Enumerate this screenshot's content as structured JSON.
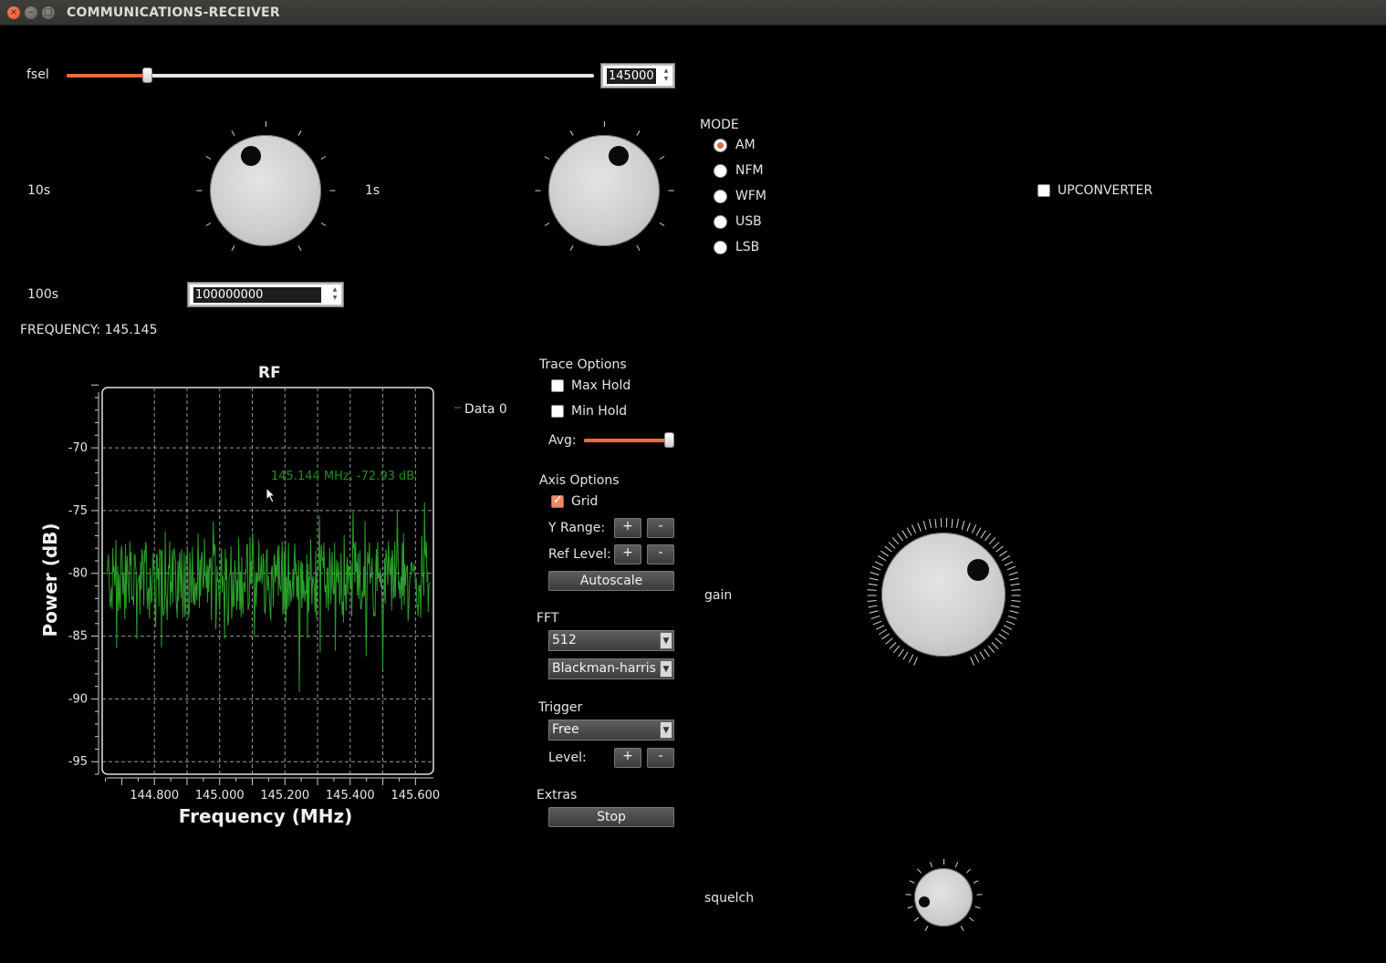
{
  "window": {
    "title": "COMMUNICATIONS-RECEIVER"
  },
  "fsel": {
    "label": "fsel",
    "value": "145000",
    "fraction": 0.152
  },
  "knobs": {
    "tens_label": "10s",
    "ones_label": "1s",
    "hundreds_label": "100s",
    "hundreds_value": "100000000"
  },
  "frequency_readout": "FREQUENCY: 145.145",
  "mode": {
    "title": "MODE",
    "options": [
      "AM",
      "NFM",
      "WFM",
      "USB",
      "LSB"
    ],
    "selected": "AM"
  },
  "upconverter": {
    "label": "UPCONVERTER",
    "checked": false
  },
  "trace_options": {
    "title": "Trace Options",
    "max_hold": "Max Hold",
    "min_hold": "Min Hold",
    "avg_label": "Avg:",
    "avg_fraction": 0.97
  },
  "axis_options": {
    "title": "Axis Options",
    "grid": "Grid",
    "grid_checked": true,
    "y_range": "Y Range:",
    "ref_level": "Ref Level:",
    "plus": "+",
    "minus": "-",
    "autoscale": "Autoscale"
  },
  "fft": {
    "title": "FFT",
    "size": "512",
    "window": "Blackman-harris"
  },
  "trigger": {
    "title": "Trigger",
    "mode": "Free",
    "level": "Level:"
  },
  "extras": {
    "title": "Extras",
    "stop": "Stop"
  },
  "gain": {
    "label": "gain"
  },
  "squelch": {
    "label": "squelch"
  },
  "chart_data": {
    "type": "line",
    "title": "RF",
    "xlabel": "Frequency (MHz)",
    "ylabel": "Power (dB)",
    "xlim": [
      144.64,
      145.655
    ],
    "ylim": [
      -96,
      -65.2
    ],
    "x_ticks": [
      "144.800",
      "145.000",
      "145.200",
      "145.400",
      "145.600"
    ],
    "x_tick_values": [
      144.8,
      145.0,
      145.2,
      145.4,
      145.6
    ],
    "y_ticks": [
      "-70",
      "-75",
      "-80",
      "-85",
      "-90",
      "-95"
    ],
    "y_tick_values": [
      -70,
      -75,
      -80,
      -85,
      -90,
      -95
    ],
    "grid": true,
    "legend_position": "right",
    "series": [
      {
        "name": "Data 0",
        "color": "#2aa02a",
        "noise_floor": -80.5
      }
    ],
    "marker_annotation": "145.144 MHz, -72.93 dB"
  },
  "colors": {
    "accent": "#ea6a3f",
    "trace": "#2aa02a",
    "background": "#000000"
  }
}
